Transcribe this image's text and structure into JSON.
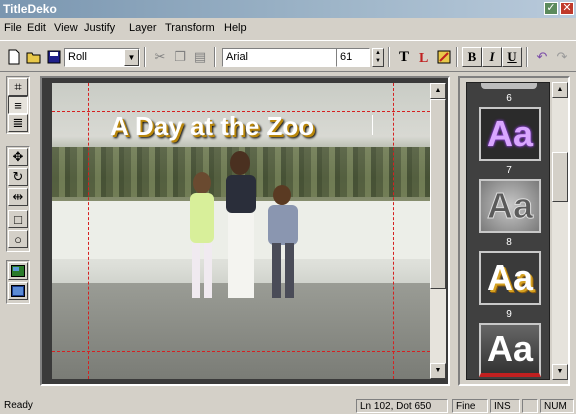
{
  "window": {
    "title": "TitleDeko",
    "maximize_glyph": "✓",
    "close_glyph": "✕"
  },
  "menu": [
    "File",
    "Edit",
    "View",
    "Justify",
    "Layer",
    "Transform",
    "Help"
  ],
  "toolbar": {
    "mode_value": "Roll",
    "font_value": "Arial",
    "size_value": "61",
    "text_btn": "T",
    "bold_label": "B",
    "italic_label": "I",
    "underline_label": "U"
  },
  "canvas": {
    "title_text": "A Day at the Zoo"
  },
  "style_panel": {
    "items": [
      {
        "number": "6",
        "sample": "Aa",
        "fill": "#8a3fd4",
        "text_color": "#d9a6ff",
        "bg": "#2b2b2b"
      },
      {
        "number": "7",
        "sample": "Aa",
        "fill": "#c0c0c0",
        "text_color": "#606060",
        "bg": "#a8a8a8"
      },
      {
        "number": "8",
        "sample": "Aa",
        "fill": "#ffffff",
        "text_color": "#ffffff",
        "bg": "#3a3a3a"
      },
      {
        "number": "9",
        "sample": "Aa",
        "fill": "#ffffff",
        "text_color": "#ffffff",
        "bg": "#555555"
      }
    ]
  },
  "status": {
    "state": "Ready",
    "position": "Ln 102, Dot 650",
    "quality": "Fine",
    "ins": "INS",
    "num": "NUM"
  },
  "colors": {
    "titlebar": "#7a96b0",
    "chrome": "#d4d0c8",
    "safe_area_guides": "#d62020"
  }
}
